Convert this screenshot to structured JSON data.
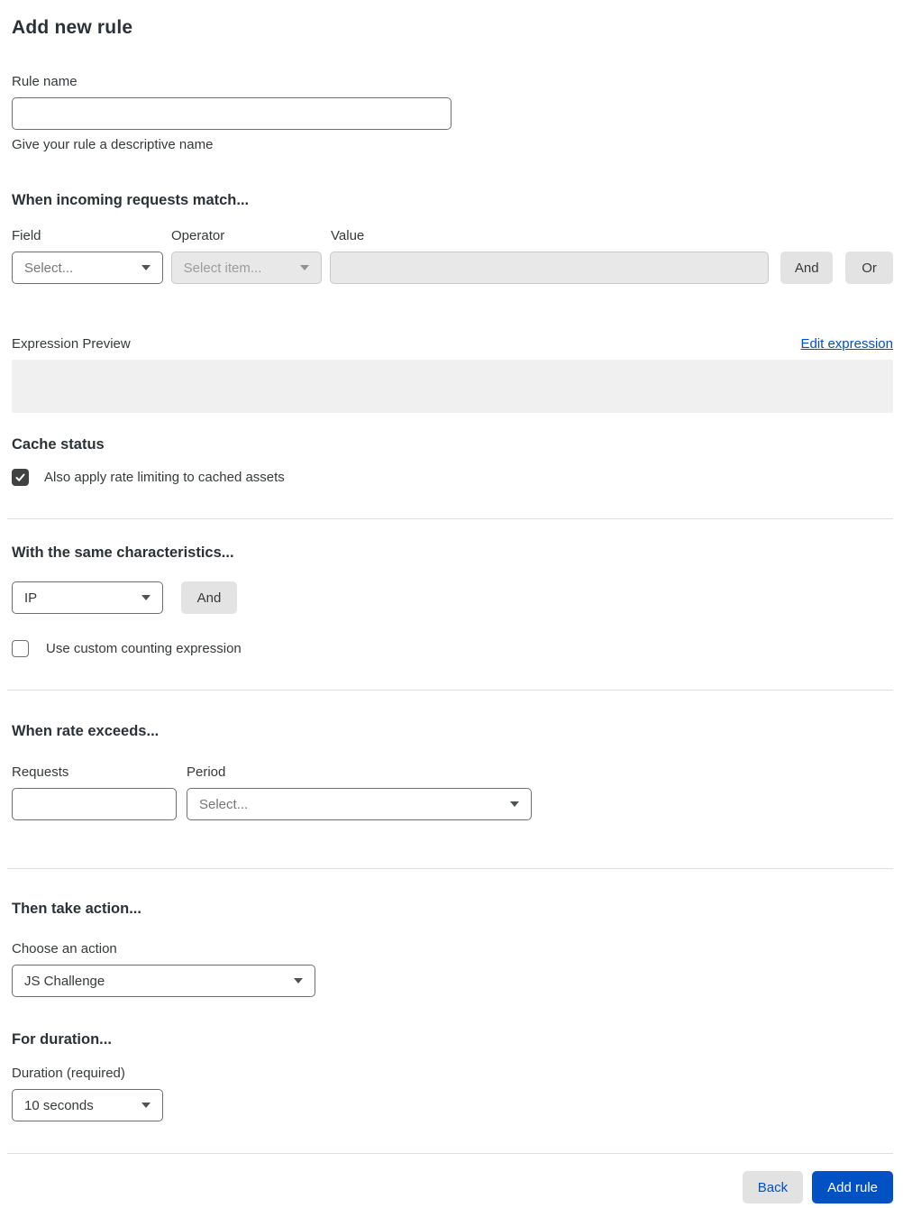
{
  "page": {
    "title": "Add new rule"
  },
  "colors": {
    "accent_blue": "#0051c3",
    "text_dark": "#36393a",
    "input_border": "#6e6e6e",
    "disabled_bg": "#e8e8e8",
    "gray_button_bg": "#e3e3e3",
    "preview_bg": "#f0f0f0",
    "checkbox_checked_bg": "#404242"
  },
  "rule_name": {
    "label": "Rule name",
    "value": "",
    "helper": "Give your rule a descriptive name"
  },
  "match": {
    "heading": "When incoming requests match...",
    "field_label": "Field",
    "field_value": "Select...",
    "operator_label": "Operator",
    "operator_value": "Select item...",
    "value_label": "Value",
    "value_value": "",
    "and_button": "And",
    "or_button": "Or"
  },
  "expression": {
    "preview_label": "Expression Preview",
    "edit_link": "Edit expression",
    "preview_value": ""
  },
  "cache_status": {
    "heading": "Cache status",
    "checkbox_label": "Also apply rate limiting to cached assets",
    "checked": true
  },
  "characteristics": {
    "heading": "With the same characteristics...",
    "select_value": "IP",
    "and_button": "And",
    "counting_checkbox_label": "Use custom counting expression",
    "counting_checked": false
  },
  "rate": {
    "heading": "When rate exceeds...",
    "requests_label": "Requests",
    "requests_value": "",
    "period_label": "Period",
    "period_value": "Select..."
  },
  "action": {
    "heading": "Then take action...",
    "choose_label": "Choose an action",
    "selected": "JS Challenge"
  },
  "duration": {
    "heading": "For duration...",
    "label": "Duration (required)",
    "selected": "10 seconds"
  },
  "footer": {
    "back_label": "Back",
    "add_rule_label": "Add rule"
  }
}
